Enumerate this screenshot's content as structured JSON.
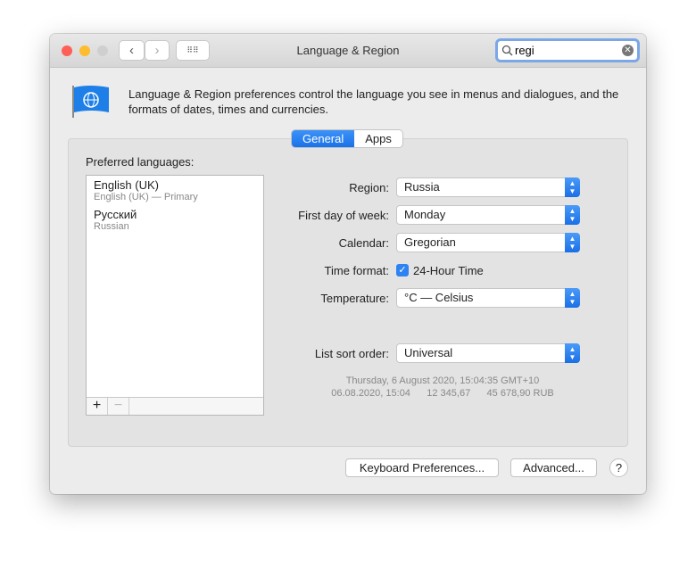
{
  "window": {
    "title": "Language & Region",
    "search_value": "regi"
  },
  "description": "Language & Region preferences control the language you see in menus and dialogues, and the formats of dates, times and currencies.",
  "tabs": [
    {
      "label": "General",
      "selected": true
    },
    {
      "label": "Apps",
      "selected": false
    }
  ],
  "preferred_languages": {
    "label": "Preferred languages:",
    "items": [
      {
        "name": "English (UK)",
        "sub": "English (UK) — Primary"
      },
      {
        "name": "Русский",
        "sub": "Russian"
      }
    ],
    "add": "+",
    "remove": "−"
  },
  "settings": {
    "region": {
      "label": "Region:",
      "value": "Russia"
    },
    "first_day": {
      "label": "First day of week:",
      "value": "Monday"
    },
    "calendar": {
      "label": "Calendar:",
      "value": "Gregorian"
    },
    "time_format": {
      "label": "Time format:",
      "value": "24-Hour Time",
      "checked": true
    },
    "temperature": {
      "label": "Temperature:",
      "value": "°C — Celsius"
    },
    "sort": {
      "label": "List sort order:",
      "value": "Universal"
    }
  },
  "sample": {
    "line1": "Thursday, 6 August 2020, 15:04:35 GMT+10",
    "line2": "06.08.2020, 15:04      12 345,67      45 678,90 RUB"
  },
  "buttons": {
    "keyboard": "Keyboard Preferences...",
    "advanced": "Advanced...",
    "help": "?"
  },
  "colors": {
    "accent": "#1a72e8",
    "close": "#fe5f57",
    "minimize": "#febc2e"
  }
}
